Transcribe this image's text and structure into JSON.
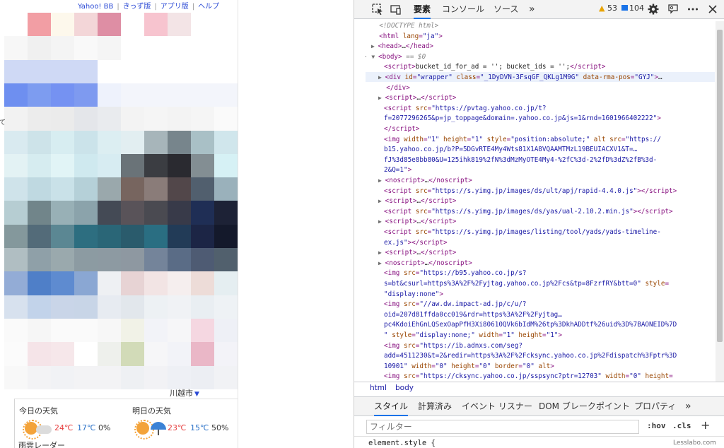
{
  "yahoo_page": {
    "top_links": [
      "Yahoo! BB",
      "きっず版",
      "アプリ版",
      "ヘルプ"
    ],
    "edge_char": "て",
    "city": "川越市",
    "weather": {
      "today": {
        "title": "今日の天気",
        "high": "24℃",
        "low": "17℃",
        "precip": "0%",
        "icons": [
          "sun-icon",
          "cloud-icon"
        ]
      },
      "tomorrow": {
        "title": "明日の天気",
        "high": "23℃",
        "low": "15℃",
        "precip": "50%",
        "icons": [
          "sun-icon",
          "umbrella-icon"
        ]
      }
    },
    "radar_label": "雨雲レーダー"
  },
  "devtools": {
    "tabs": [
      "要素",
      "コンソール",
      "ソース"
    ],
    "active_tab": "要素",
    "more_tabs": "»",
    "warnings": "53",
    "messages": "104",
    "source_lines": [
      {
        "indent": 0,
        "arrow": "",
        "html": "<span class='cm'>&lt;!DOCTYPE html&gt;</span>"
      },
      {
        "indent": 0,
        "arrow": "",
        "html": "<span class='t'>&lt;html</span> <span class='a'>lang</span>=<span class='v'>\"ja\"</span><span class='t'>&gt;</span>"
      },
      {
        "indent": 0,
        "arrow": "▶",
        "html": "<span class='t'>&lt;head&gt;</span><span class='txt'>…</span><span class='t'>&lt;/head&gt;</span>"
      },
      {
        "indent": 0,
        "arrow": "▼",
        "html": "<span class='t'>&lt;body&gt;</span> <span class='cm'>== $0</span>",
        "prefix": "··· "
      },
      {
        "indent": 2,
        "arrow": "",
        "html": "<span class='t'>&lt;script&gt;</span><span class='txt'>bucket_id_for_ad = ''; bucket_ids = '';</span><span class='t'>&lt;/script&gt;</span>"
      },
      {
        "indent": 1,
        "arrow": "▶",
        "html": "<span class='t'>&lt;div</span> <span class='a'>id</span>=<span class='v'>\"wrapper\"</span> <span class='a'>class</span>=<span class='v'>\"_1DyDVN-3FsqGF_QKLg1M9G\"</span> <span class='a'>data-rma-pos</span>=<span class='v'>\"GYJ\"</span><span class='t'>&gt;</span><span class='txt'>…</span>"
      },
      {
        "indent": 1,
        "arrow": "",
        "html": "<span class='t'>&lt;/div&gt;</span>"
      },
      {
        "indent": 1,
        "arrow": "▶",
        "html": "<span class='t'>&lt;script&gt;</span><span class='txt'>…</span><span class='t'>&lt;/script&gt;</span>"
      },
      {
        "indent": 2,
        "arrow": "",
        "html": "<span class='t'>&lt;script</span> <span class='a'>src</span>=<span class='v'>\"https://pvtag.yahoo.co.jp/t?</span>"
      },
      {
        "indent": 2,
        "arrow": "",
        "html": "<span class='v'>f=2077296265&amp;p=jp_toppage&amp;domain=.yahoo.co.jp&amp;js=1&amp;rnd=1601966402222\"</span><span class='t'>&gt;</span>"
      },
      {
        "indent": 2,
        "arrow": "",
        "html": "<span class='t'>&lt;/script&gt;</span>"
      },
      {
        "indent": 2,
        "arrow": "",
        "html": "<span class='t'>&lt;img</span> <span class='a'>width</span>=<span class='v'>\"1\"</span> <span class='a'>height</span>=<span class='v'>\"1\"</span> <span class='a'>style</span>=<span class='v'>\"position:absolute;\"</span> <span class='a'>alt src</span>=<span class='v'>\"https://</span>"
      },
      {
        "indent": 2,
        "arrow": "",
        "html": "<span class='v'>b15.yahoo.co.jp/b?P=5DGvRTE4My4Wts81X1A8VQAAMTMzL19BEUIACXV1&amp;T=…</span>"
      },
      {
        "indent": 2,
        "arrow": "",
        "html": "<span class='v'>fJ%3d85e8bb80&amp;U=125ihk819%2fN%3dMzMyOTE4My4-%2fC%3d-2%2fD%3dZ%2fB%3d-</span>"
      },
      {
        "indent": 2,
        "arrow": "",
        "html": "<span class='v'>2&amp;Q=1\"</span><span class='t'>&gt;</span>"
      },
      {
        "indent": 1,
        "arrow": "▶",
        "html": "<span class='t'>&lt;noscript&gt;</span><span class='txt'>…</span><span class='t'>&lt;/noscript&gt;</span>"
      },
      {
        "indent": 2,
        "arrow": "",
        "html": "<span class='t'>&lt;script</span> <span class='a'>src</span>=<span class='v'>\"https://s.yimg.jp/images/ds/ult/apj/rapid-4.4.0.js\"</span><span class='t'>&gt;&lt;/script&gt;</span>"
      },
      {
        "indent": 1,
        "arrow": "▶",
        "html": "<span class='t'>&lt;script&gt;</span><span class='txt'>…</span><span class='t'>&lt;/script&gt;</span>"
      },
      {
        "indent": 2,
        "arrow": "",
        "html": "<span class='t'>&lt;script</span> <span class='a'>src</span>=<span class='v'>\"https://s.yimg.jp/images/ds/yas/ual-2.10.2.min.js\"</span><span class='t'>&gt;&lt;/script&gt;</span>"
      },
      {
        "indent": 1,
        "arrow": "▶",
        "html": "<span class='t'>&lt;script&gt;</span><span class='txt'>…</span><span class='t'>&lt;/script&gt;</span>"
      },
      {
        "indent": 2,
        "arrow": "",
        "html": "<span class='t'>&lt;script</span> <span class='a'>src</span>=<span class='v'>\"https://s.yimg.jp/images/listing/tool/yads/yads-timeline-</span>"
      },
      {
        "indent": 2,
        "arrow": "",
        "html": "<span class='v'>ex.js\"</span><span class='t'>&gt;&lt;/script&gt;</span>"
      },
      {
        "indent": 1,
        "arrow": "▶",
        "html": "<span class='t'>&lt;script&gt;</span><span class='txt'>…</span><span class='t'>&lt;/script&gt;</span>"
      },
      {
        "indent": 1,
        "arrow": "▶",
        "html": "<span class='t'>&lt;noscript&gt;</span><span class='txt'>…</span><span class='t'>&lt;/noscript&gt;</span>"
      },
      {
        "indent": 2,
        "arrow": "",
        "html": "<span class='t'>&lt;img</span> <span class='a'>src</span>=<span class='v'>\"https://b95.yahoo.co.jp/s?</span>"
      },
      {
        "indent": 2,
        "arrow": "",
        "html": "<span class='v'>s=bt&amp;csurl=https%3A%2F%2Fyjtag.yahoo.co.jp%2Fcs&amp;tp=8FzrfRY&amp;btt=0\"</span> <span class='a'>style</span>="
      },
      {
        "indent": 2,
        "arrow": "",
        "html": "<span class='v'>\"display:none\"</span><span class='t'>&gt;</span>"
      },
      {
        "indent": 2,
        "arrow": "",
        "html": "<span class='t'>&lt;img</span> <span class='a'>src</span>=<span class='v'>\"//aw.dw.impact-ad.jp/c/u/?</span>"
      },
      {
        "indent": 2,
        "arrow": "",
        "html": "<span class='v'>oid=207d81ffda0cc019&amp;rdr=https%3A%2F%2Fyjtag…</span>"
      },
      {
        "indent": 2,
        "arrow": "",
        "html": "<span class='v'>pc4KdoiEhGnLQSexOapPfH3Xi80610QVk6bIdM%26tp%3DkhADDtf%26uid%3D%7BAONEID%7D</span>"
      },
      {
        "indent": 2,
        "arrow": "",
        "html": "<span class='v'>\"</span> <span class='a'>style</span>=<span class='v'>\"display:none;\"</span> <span class='a'>width</span>=<span class='v'>\"1\"</span> <span class='a'>height</span>=<span class='v'>\"1\"</span><span class='t'>&gt;</span>"
      },
      {
        "indent": 2,
        "arrow": "",
        "html": "<span class='t'>&lt;img</span> <span class='a'>src</span>=<span class='v'>\"https://ib.adnxs.com/seg?</span>"
      },
      {
        "indent": 2,
        "arrow": "",
        "html": "<span class='v'>add=4511230&amp;t=2&amp;redir=https%3A%2F%2Fcksync.yahoo.co.jp%2Fdispatch%3Fptr%3D</span>"
      },
      {
        "indent": 2,
        "arrow": "",
        "html": "<span class='v'>10901\"</span> <span class='a'>width</span>=<span class='v'>\"0\"</span> <span class='a'>height</span>=<span class='v'>\"0\"</span> <span class='a'>border</span>=<span class='v'>\"0\"</span> <span class='a'>alt</span><span class='t'>&gt;</span>"
      },
      {
        "indent": 2,
        "arrow": "",
        "html": "<span class='t'>&lt;img</span> <span class='a'>src</span>=<span class='v'>\"https://cksync.yahoo.co.jp/sspsync?ptr=12703\"</span> <span class='a'>width</span>=<span class='v'>\"0\"</span> <span class='a'>height</span>="
      }
    ],
    "breadcrumbs": [
      "html",
      "body"
    ],
    "style_tabs": [
      "スタイル",
      "計算済み",
      "イベント リスナー",
      "DOM ブレークポイント",
      "プロパティ"
    ],
    "active_style_tab": "スタイル",
    "style_more": "»",
    "filter_placeholder": "フィルター",
    "hov_label": ":hov",
    "cls_label": ".cls",
    "add_rule": "+",
    "element_style": "element.style {"
  },
  "watermark": "Lesslabo.com",
  "colors": {
    "accent": "#1a73e8",
    "tag": "#881280",
    "attr": "#994500",
    "value": "#1a1aa6",
    "link": "#2b4ad5"
  }
}
